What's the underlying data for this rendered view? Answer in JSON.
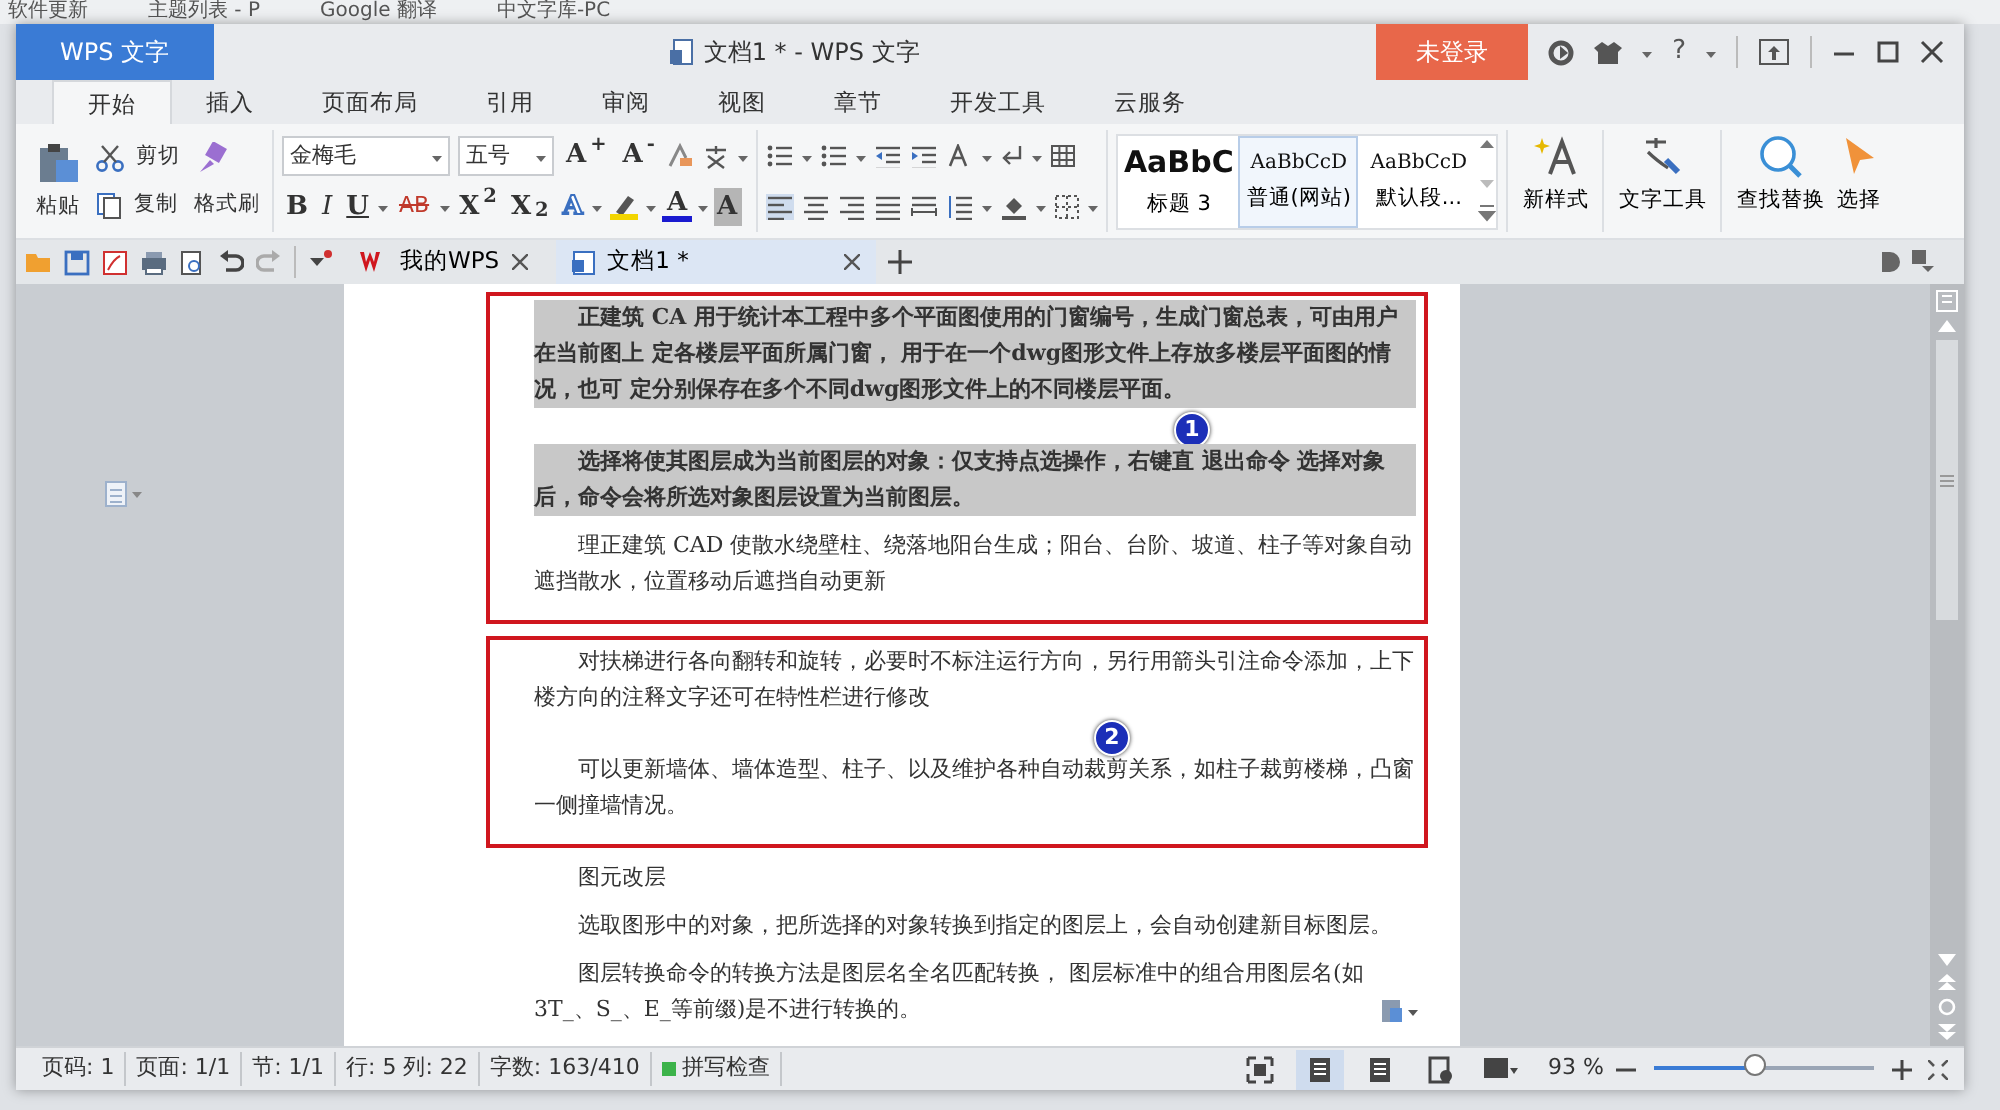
{
  "bookmarks": [
    "软件更新",
    "主题列表 - P",
    "Google 翻译",
    "中文字库-PC"
  ],
  "window": {
    "app_tab": "WPS 文字",
    "title": "文档1 * - WPS 文字",
    "login_button": "未登录",
    "help": "?"
  },
  "menu_tabs": [
    {
      "label": "开始",
      "selected": true
    },
    {
      "label": "插入",
      "selected": false
    },
    {
      "label": "页面布局",
      "selected": false
    },
    {
      "label": "引用",
      "selected": false
    },
    {
      "label": "审阅",
      "selected": false
    },
    {
      "label": "视图",
      "selected": false
    },
    {
      "label": "章节",
      "selected": false
    },
    {
      "label": "开发工具",
      "selected": false
    },
    {
      "label": "云服务",
      "selected": false
    }
  ],
  "ribbon": {
    "paste": "粘贴",
    "cut": "剪切",
    "copy": "复制",
    "format_painter": "格式刷",
    "font_name": "金梅毛",
    "font_size": "五号",
    "grow_font": "A$^{+}$",
    "shrink_font": "A$^{-}$",
    "bold": "B",
    "italic": "I",
    "underline": "U",
    "strikethrough": "AB",
    "superscript": "X$^{2}$",
    "subscript": "X$_{2}$",
    "text_effect": "A",
    "font_color": "A",
    "char_shading": "A",
    "styles": [
      {
        "preview": "AaBbC",
        "name": "标题 3",
        "selected": false
      },
      {
        "preview": "AaBbCcD",
        "name": "普通(网站)",
        "selected": true
      },
      {
        "preview": "AaBbCcD",
        "name": "默认段...",
        "selected": false
      }
    ],
    "new_style": "新样式",
    "text_tools": "文字工具",
    "find_replace": "查找替换",
    "select": "选择"
  },
  "doc_tabs": [
    {
      "label": "我的WPS",
      "kind": "home",
      "selected": false
    },
    {
      "label": "文档1 *",
      "kind": "doc",
      "selected": true
    }
  ],
  "body": [
    {
      "kind": "annotation",
      "number": "1",
      "paragraphs": [
        {
          "text": "正建筑 CA  用于统计本工程中多个平面图使用的门窗编号，生成门窗总表，可由用户在当前图上  定各楼层平面所属门窗，  用于在一个dwg图形文件上存放多楼层平面图的情况，也可  定分别保存在多个不同dwg图形文件上的不同楼层平面。",
          "highlighted": true
        },
        {
          "text": "选择将使其图层成为当前图层的对象：仅支持点选操作，右键直  退出命令  选择对象后，命令会将所选对象图层设置为当前图层。",
          "highlighted": true
        },
        {
          "text": "理正建筑 CAD 使散水绕壁柱、绕落地阳台生成；阳台、台阶、坡道、柱子等对象自动遮挡散水，位置移动后遮挡自动更新",
          "highlighted": false
        }
      ]
    },
    {
      "kind": "annotation",
      "number": "2",
      "paragraphs": [
        {
          "text": "对扶梯进行各向翻转和旋转，必要时不标注运行方向，另行用箭头引注命令添加，上下楼方向的注释文字还可在特性栏进行修改",
          "highlighted": false
        },
        {
          "text": "可以更新墙体、墙体造型、柱子、以及维护各种自动裁剪关系，如柱子裁剪楼梯，凸窗一侧撞墙情况。",
          "highlighted": false
        }
      ]
    },
    {
      "kind": "paragraph",
      "text": "图元改层",
      "highlighted": false
    },
    {
      "kind": "paragraph",
      "text": "选取图形中的对象，把所选择的对象转换到指定的图层上，会自动创建新目标图层。",
      "highlighted": false
    },
    {
      "kind": "paragraph",
      "text": "图层转换命令的转换方法是图层名全名匹配转换， 图层标准中的组合用图层名(如 3T_、S_、E_等前缀)是不进行转换的。",
      "highlighted": false
    }
  ],
  "status_bar": {
    "items": [
      "页码: 1",
      "页面: 1/1",
      "节: 1/1",
      "行: 5  列: 22",
      "字数: 163/410"
    ],
    "spell_check": "拼写检查",
    "views": [
      {
        "kind": "full",
        "selected": false
      },
      {
        "kind": "page",
        "selected": true
      },
      {
        "kind": "outline",
        "selected": false
      },
      {
        "kind": "web",
        "selected": false
      },
      {
        "kind": "reading",
        "selected": false
      }
    ],
    "zoom": "93 %",
    "zoom_slider": {
      "level": 0.45
    }
  }
}
